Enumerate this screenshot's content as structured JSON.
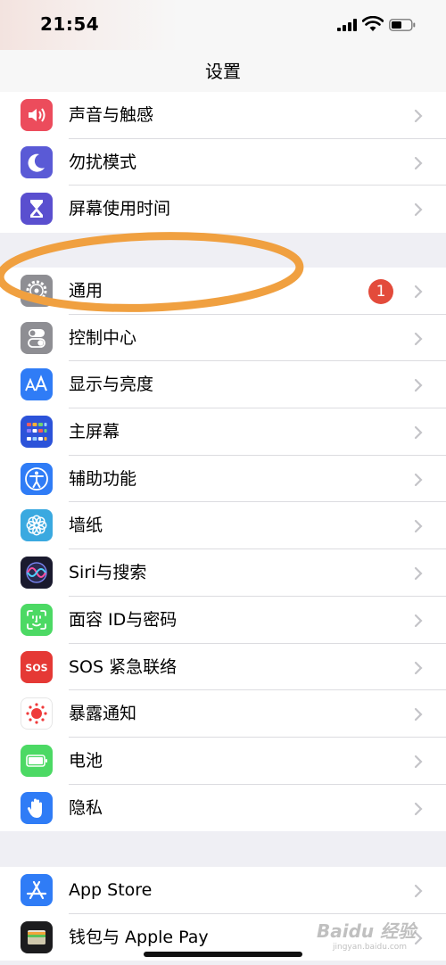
{
  "status_bar": {
    "time": "21:54"
  },
  "nav": {
    "title": "设置"
  },
  "group1": [
    {
      "label": "声音与触感",
      "icon": "speaker-icon",
      "color": "#ec4c5c"
    },
    {
      "label": "勿扰模式",
      "icon": "moon-icon",
      "color": "#5a5ad6"
    },
    {
      "label": "屏幕使用时间",
      "icon": "hourglass-icon",
      "color": "#5a4fcf"
    }
  ],
  "group2": [
    {
      "label": "通用",
      "icon": "gear-icon",
      "color": "#8e8e93",
      "badge": "1"
    },
    {
      "label": "控制中心",
      "icon": "toggles-icon",
      "color": "#8e8e93"
    },
    {
      "label": "显示与亮度",
      "icon": "text-size-icon",
      "color": "#2f7cf6"
    },
    {
      "label": "主屏幕",
      "icon": "home-screen-grid-icon",
      "color": "#2c53d9"
    },
    {
      "label": "辅助功能",
      "icon": "accessibility-icon",
      "color": "#2f7cf6"
    },
    {
      "label": "墙纸",
      "icon": "flower-icon",
      "color": "#3aa9e0"
    },
    {
      "label": "Siri与搜索",
      "icon": "siri-icon",
      "color": "#1a1a2e"
    },
    {
      "label": "面容 ID与密码",
      "icon": "face-id-icon",
      "color": "#4cd964"
    },
    {
      "label": "SOS 紧急联络",
      "icon": "sos-icon",
      "color": "#e53935"
    },
    {
      "label": "暴露通知",
      "icon": "exposure-icon",
      "color": "#ffffff"
    },
    {
      "label": "电池",
      "icon": "battery-icon",
      "color": "#4cd964"
    },
    {
      "label": "隐私",
      "icon": "hand-icon",
      "color": "#2f7cf6"
    }
  ],
  "group3": [
    {
      "label": "App Store",
      "icon": "app-store-icon",
      "color": "#2f7cf6"
    },
    {
      "label": "钱包与 Apple Pay",
      "icon": "wallet-icon",
      "color": "#1c1c1e"
    }
  ],
  "annotation": {
    "shape": "ellipse",
    "color": "#f0a040",
    "highlights": "通用"
  },
  "watermark": {
    "text": "Baidu 经验",
    "url": "jingyan.baidu.com"
  }
}
